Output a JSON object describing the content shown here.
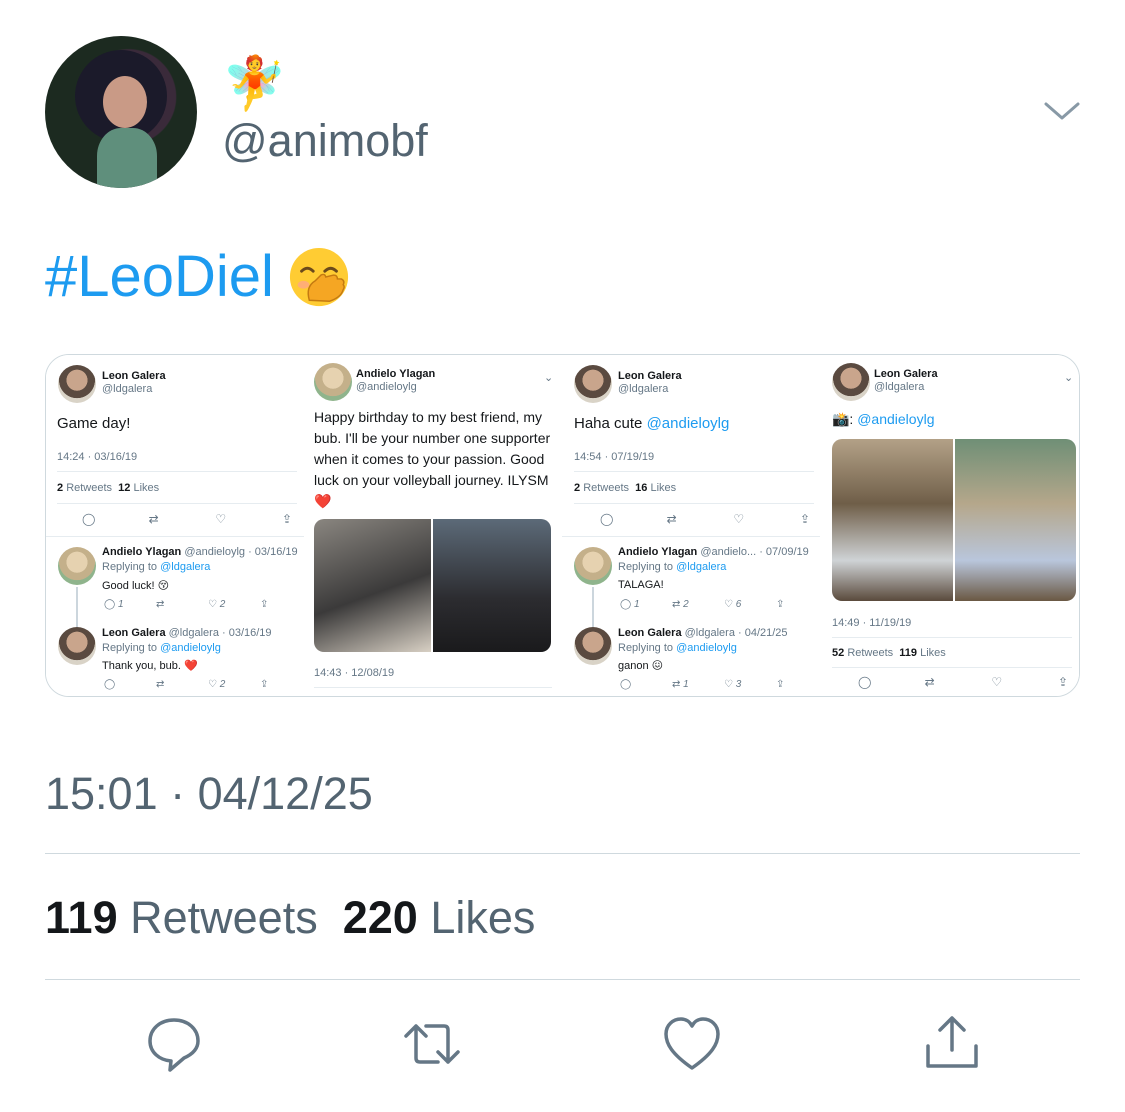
{
  "author": {
    "emoji": "🧚",
    "handle": "@animobf"
  },
  "tweet": {
    "hashtag": "#LeoDiel",
    "emoji_icon": "face-with-hand-over-mouth-icon",
    "timestamp": "15:01 · 04/12/25"
  },
  "stats": {
    "retweets": "119",
    "retweets_label": "Retweets",
    "likes": "220",
    "likes_label": "Likes"
  },
  "media": {
    "panel1": {
      "name": "Leon Galera",
      "handle": "@ldgalera",
      "body": "Game day!",
      "time": "14:24 · 03/16/19",
      "retweets": "2",
      "retweets_label": "Retweets",
      "likes": "12",
      "likes_label": "Likes",
      "replies": [
        {
          "name": "Andielo Ylagan",
          "meta": "@andieloylg · 03/16/19",
          "replying": "Replying to",
          "to": "@ldgalera",
          "text": "Good luck! 😚",
          "c1": "1",
          "c3": "2"
        },
        {
          "name": "Leon Galera",
          "meta": "@ldgalera · 03/16/19",
          "replying": "Replying to",
          "to": "@andieloylg",
          "text": "Thank you, bub. ❤️",
          "c3": "2"
        }
      ]
    },
    "panel2": {
      "name": "Andielo Ylagan",
      "handle": "@andieloylg",
      "body": "Happy birthday to my best friend, my bub. I'll be your number one supporter when it comes to your passion. Good luck on your volleyball journey. ILYSM ❤️",
      "time": "14:43 · 12/08/19"
    },
    "panel3": {
      "name": "Leon Galera",
      "handle": "@ldgalera",
      "body": "Haha cute",
      "mention": "@andieloylg",
      "time": "14:54 · 07/19/19",
      "retweets": "2",
      "retweets_label": "Retweets",
      "likes": "16",
      "likes_label": "Likes",
      "replies": [
        {
          "name": "Andielo Ylagan",
          "meta": "@andielo... · 07/09/19",
          "replying": "Replying to",
          "to": "@ldgalera",
          "text": "TALAGA!",
          "c1": "1",
          "c2": "2",
          "c3": "6"
        },
        {
          "name": "Leon Galera",
          "meta": "@ldgalera · 04/21/25",
          "replying": "Replying to",
          "to": "@andieloylg",
          "text": "ganon 😖",
          "c2": "1",
          "c3": "3"
        }
      ]
    },
    "panel4": {
      "name": "Leon Galera",
      "handle": "@ldgalera",
      "camera": "📸:",
      "mention": "@andieloylg",
      "time": "14:49 · 11/19/19",
      "retweets": "52",
      "retweets_label": "Retweets",
      "likes": "119",
      "likes_label": "Likes"
    }
  },
  "colors": {
    "link": "#1d9bf0",
    "secondary": "#536471",
    "border": "#cfd9de"
  }
}
